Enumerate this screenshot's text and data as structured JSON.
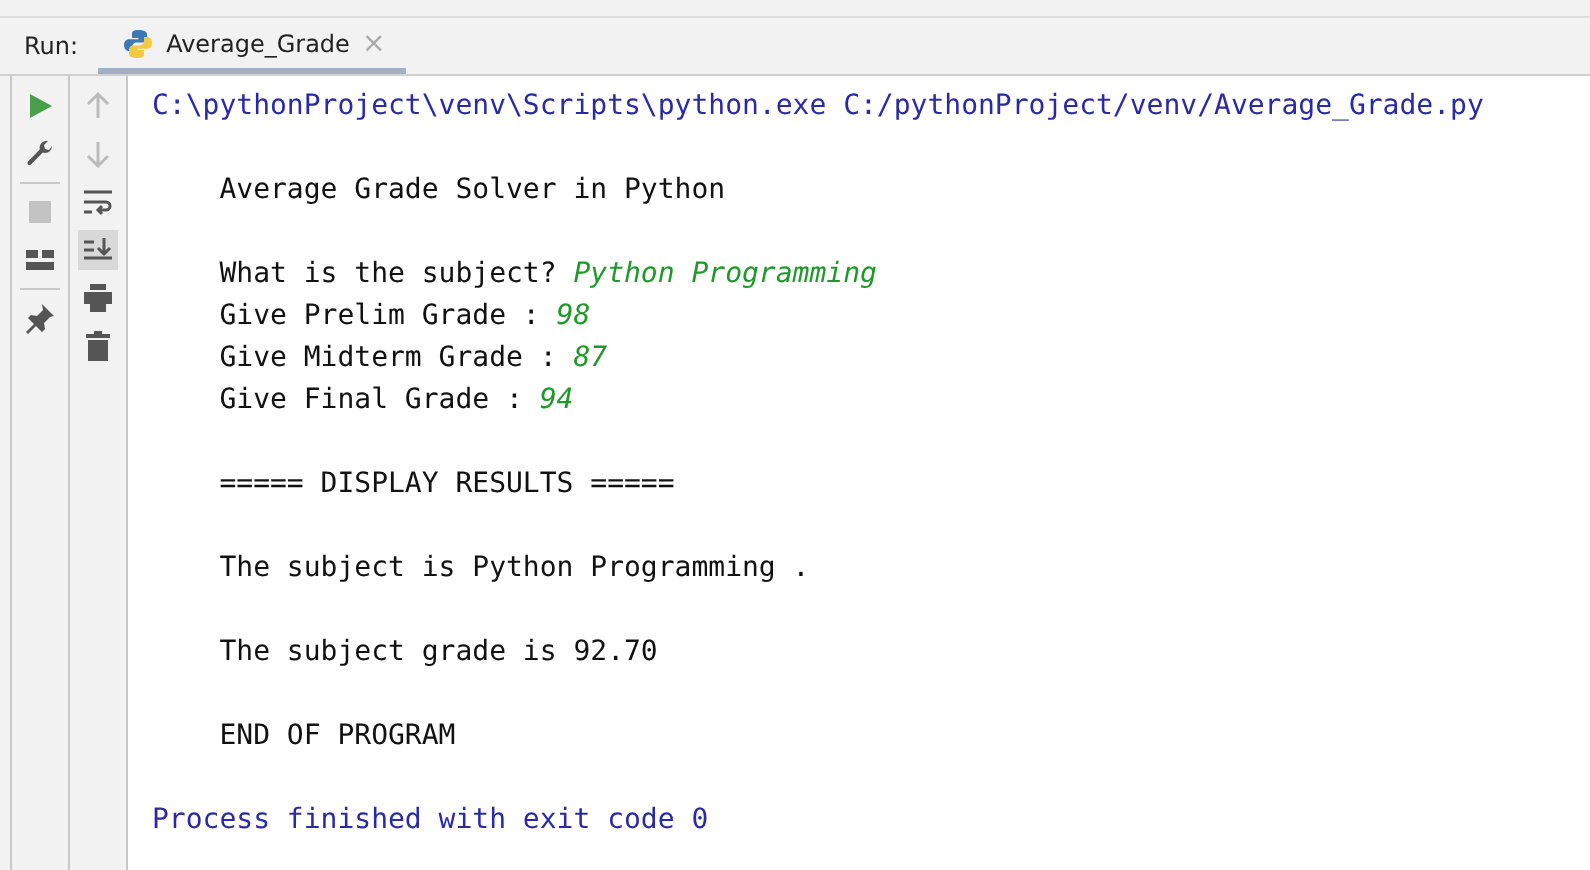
{
  "run_panel": {
    "label": "Run:",
    "tabs": [
      {
        "label": "Average_Grade",
        "selected": true,
        "close": "×"
      }
    ]
  },
  "toolbar_left": [
    {
      "kind": "run",
      "disabled": false
    },
    {
      "kind": "wrench",
      "disabled": false
    },
    {
      "kind": "separator"
    },
    {
      "kind": "stop",
      "disabled": true
    },
    {
      "kind": "layout",
      "disabled": false
    },
    {
      "kind": "separator"
    },
    {
      "kind": "pin",
      "disabled": false
    }
  ],
  "toolbar_right": [
    {
      "kind": "up",
      "disabled": true,
      "selected": false
    },
    {
      "kind": "down",
      "disabled": true,
      "selected": false
    },
    {
      "kind": "wrap",
      "disabled": false,
      "selected": false
    },
    {
      "kind": "scroll-end",
      "disabled": false,
      "selected": true
    },
    {
      "kind": "print",
      "disabled": false,
      "selected": false
    },
    {
      "kind": "trash",
      "disabled": false,
      "selected": false
    }
  ],
  "console": [
    {
      "kind": "command",
      "text": "C:\\pythonProject\\venv\\Scripts\\python.exe C:/pythonProject/venv/Average_Grade.py"
    },
    {
      "kind": "blank"
    },
    {
      "kind": "output",
      "text": "    Average Grade Solver in Python"
    },
    {
      "kind": "blank"
    },
    {
      "kind": "prompt",
      "text": "    What is the subject? ",
      "input": "Python Programming"
    },
    {
      "kind": "prompt",
      "text": "    Give Prelim Grade : ",
      "input": "98"
    },
    {
      "kind": "prompt",
      "text": "    Give Midterm Grade : ",
      "input": "87"
    },
    {
      "kind": "prompt",
      "text": "    Give Final Grade : ",
      "input": "94"
    },
    {
      "kind": "blank"
    },
    {
      "kind": "output",
      "text": "    ===== DISPLAY RESULTS ====="
    },
    {
      "kind": "blank"
    },
    {
      "kind": "output",
      "text": "    The subject is Python Programming ."
    },
    {
      "kind": "blank"
    },
    {
      "kind": "output",
      "text": "    The subject grade is 92.70"
    },
    {
      "kind": "blank"
    },
    {
      "kind": "output",
      "text": "    END OF PROGRAM"
    },
    {
      "kind": "blank"
    },
    {
      "kind": "process",
      "text": "Process finished with exit code 0"
    }
  ]
}
